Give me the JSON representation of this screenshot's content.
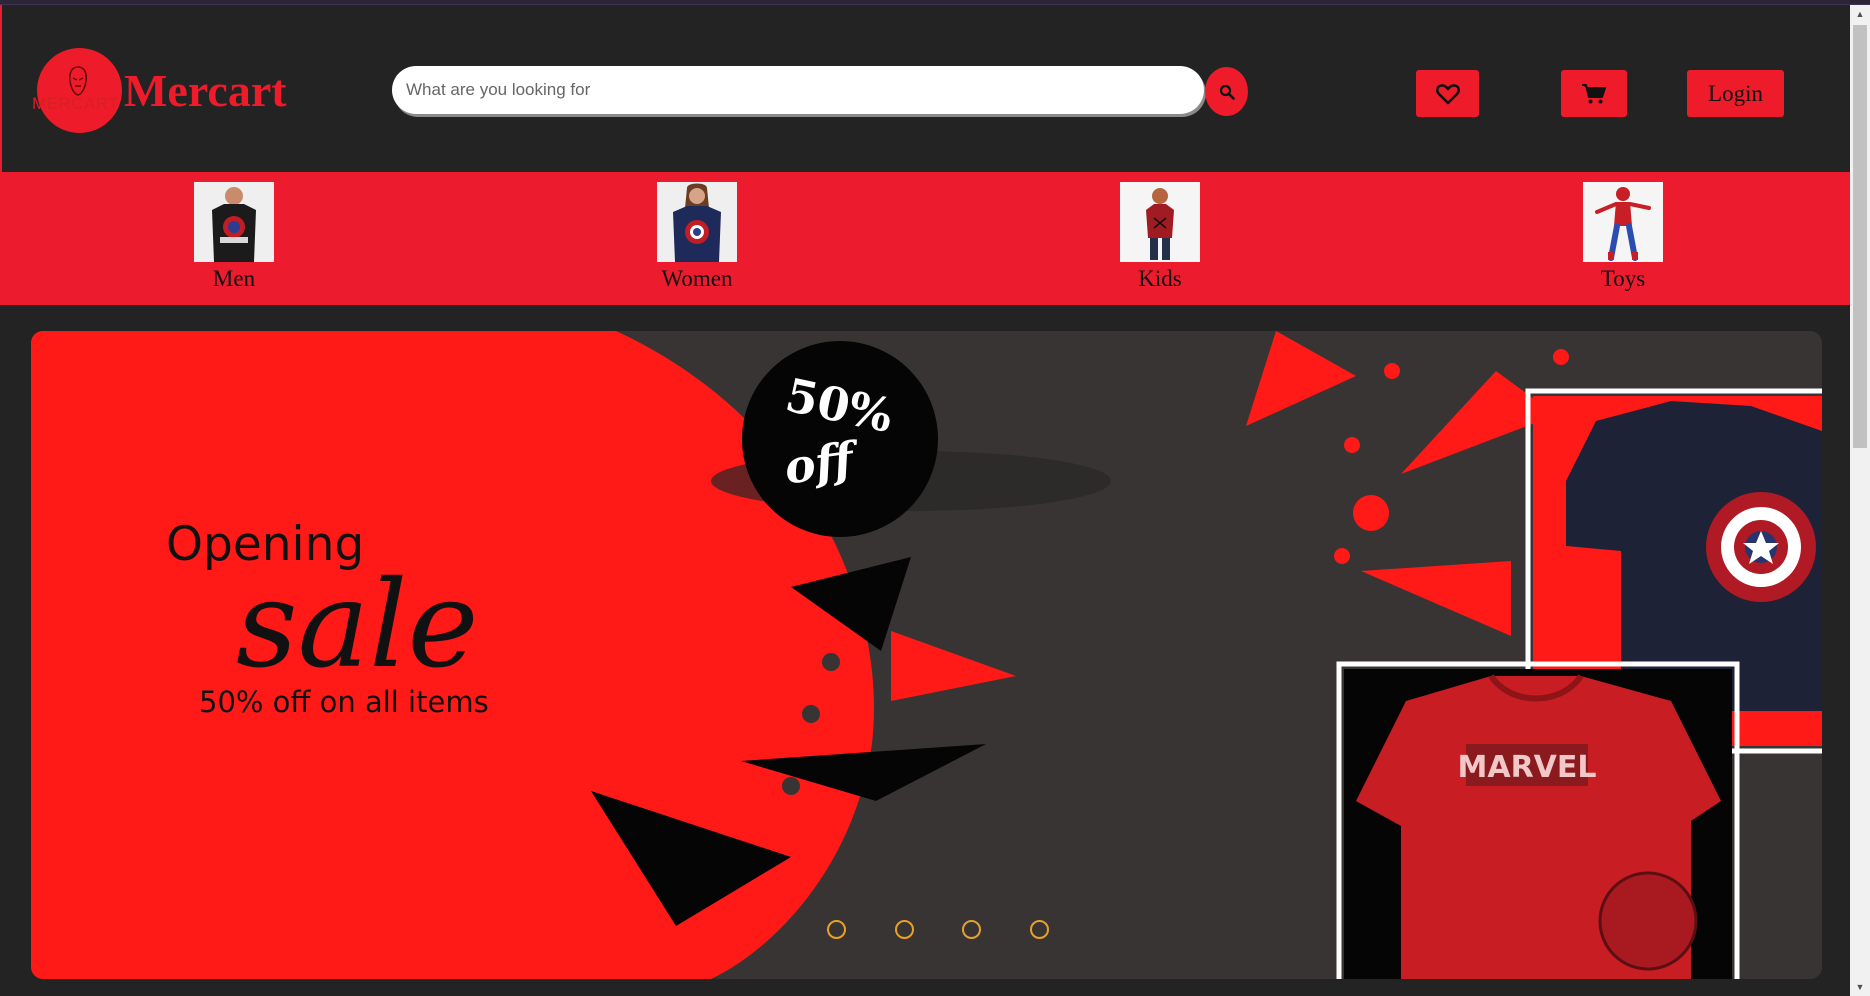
{
  "header": {
    "logo_small_text": "MERCART",
    "logo_name": "Mercart",
    "search_placeholder": "What are you looking for",
    "search_icon": "search-icon",
    "wishlist_icon": "heart-icon",
    "cart_icon": "cart-icon",
    "login_label": "Login"
  },
  "categories": [
    {
      "label": "Men",
      "icon": "men-tshirt-photo"
    },
    {
      "label": "Women",
      "icon": "women-tshirt-photo"
    },
    {
      "label": "Kids",
      "icon": "kids-tshirt-photo"
    },
    {
      "label": "Toys",
      "icon": "spiderman-toy-photo"
    }
  ],
  "banner": {
    "badge_line1": "50%",
    "badge_line2": "off",
    "heading": "Opening",
    "script_word": "sale",
    "subheading": "50% off on all items",
    "shirt_print_text": "MARVEL",
    "slide_count": 4
  },
  "colors": {
    "accent": "#ee1b2b",
    "background": "#232323",
    "banner_dark": "#383434",
    "dot_color": "#e7a12a"
  }
}
